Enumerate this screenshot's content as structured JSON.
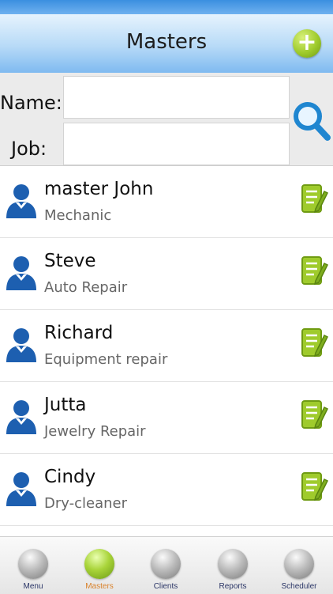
{
  "header": {
    "title": "Masters",
    "add_icon": "plus-circle-icon"
  },
  "search": {
    "name_label": "Name:",
    "job_label": "Job:",
    "name_value": "",
    "job_value": "",
    "search_icon": "magnifier-icon"
  },
  "masters": [
    {
      "name": "master John",
      "job": "Mechanic"
    },
    {
      "name": "Steve",
      "job": "Auto Repair"
    },
    {
      "name": "Richard",
      "job": "Equipment repair"
    },
    {
      "name": "Jutta",
      "job": "Jewelry Repair"
    },
    {
      "name": "Cindy",
      "job": "Dry-cleaner"
    }
  ],
  "tabs": [
    {
      "label": "Menu",
      "active": false
    },
    {
      "label": "Masters",
      "active": true
    },
    {
      "label": "Clients",
      "active": false
    },
    {
      "label": "Reports",
      "active": false
    },
    {
      "label": "Scheduler",
      "active": false
    }
  ],
  "colors": {
    "accent_green": "#9fcb2c",
    "header_blue": "#7fbaf0",
    "active_tab_text": "#d9822b",
    "avatar_blue": "#1d5fb0"
  }
}
